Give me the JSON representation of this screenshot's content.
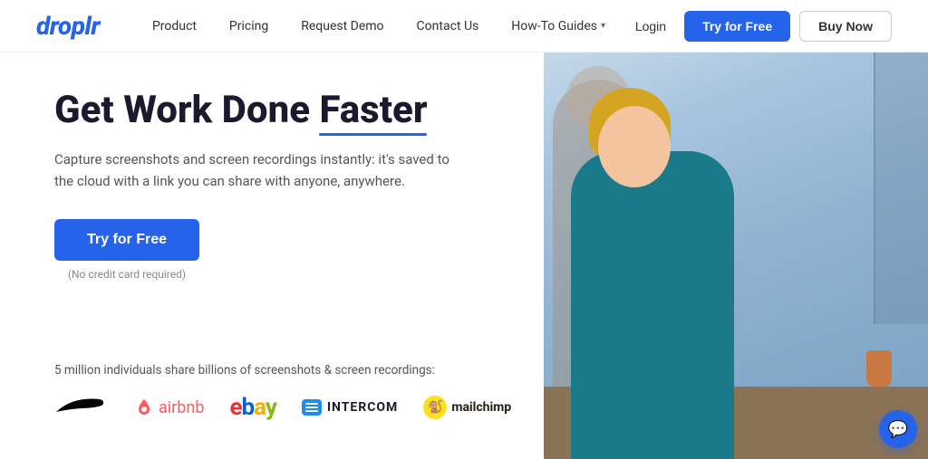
{
  "header": {
    "logo": "droplr",
    "nav": {
      "product": "Product",
      "pricing": "Pricing",
      "requestDemo": "Request Demo",
      "contactUs": "Contact Us",
      "howToGuides": "How-To Guides",
      "login": "Login"
    },
    "tryFreeBtn": "Try for Free",
    "buyNowBtn": "Buy Now"
  },
  "hero": {
    "headingPart1": "Get Work Done ",
    "headingHighlight": "Faster",
    "subtext": "Capture screenshots and screen recordings instantly: it's saved to the cloud with a link you can share with anyone, anywhere.",
    "ctaButton": "Try for Free",
    "noCreditCard": "(No credit card required)"
  },
  "socialProof": {
    "text": "5 million individuals share billions of screenshots & screen recordings:",
    "logos": [
      "Nike",
      "airbnb",
      "ebay",
      "INTERCOM",
      "mailchimp"
    ]
  },
  "chat": {
    "icon": "💬"
  }
}
